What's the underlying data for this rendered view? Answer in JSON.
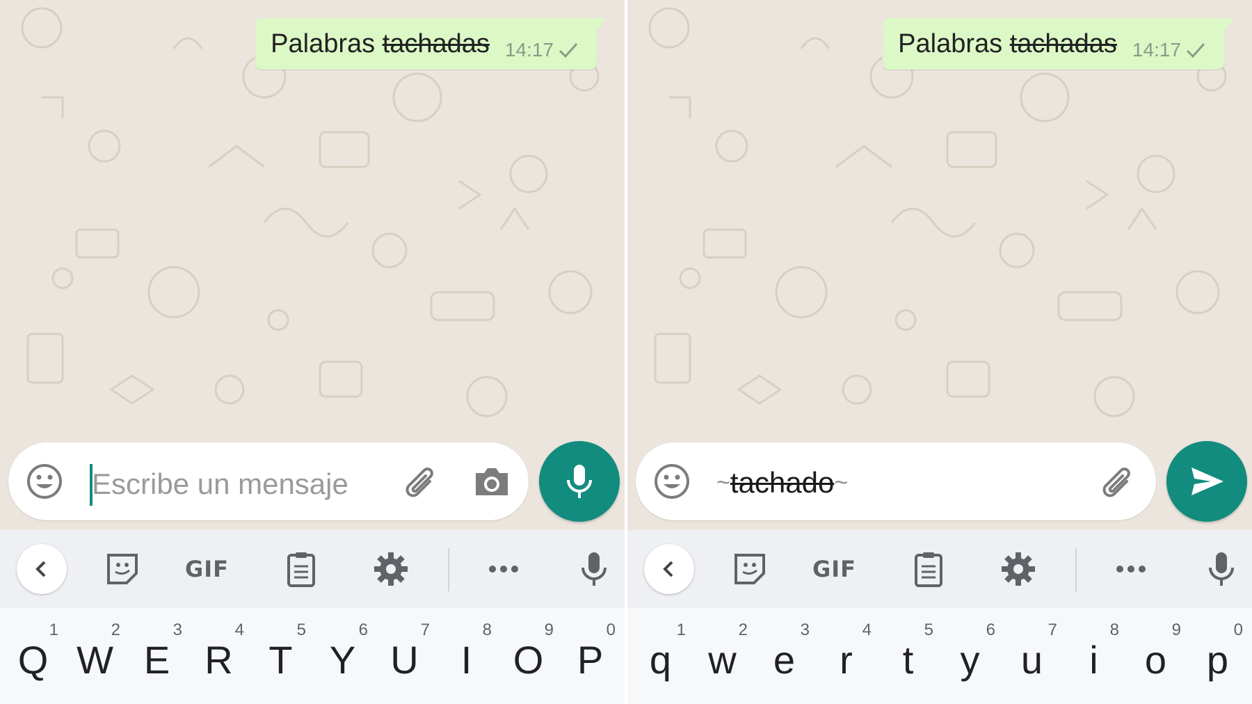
{
  "panels": [
    {
      "message": {
        "plain": "Palabras ",
        "struck": "tachadas",
        "time": "14:17"
      },
      "composer": {
        "placeholder": "Escribe un mensaje",
        "tilde_open": "",
        "typed": "",
        "tilde_close": ""
      },
      "fab": "mic-icon",
      "toolbar": {
        "gif_label": "GIF"
      },
      "keyboard": {
        "keys": [
          {
            "char": "Q",
            "hint": "1"
          },
          {
            "char": "W",
            "hint": "2"
          },
          {
            "char": "E",
            "hint": "3"
          },
          {
            "char": "R",
            "hint": "4"
          },
          {
            "char": "T",
            "hint": "5"
          },
          {
            "char": "Y",
            "hint": "6"
          },
          {
            "char": "U",
            "hint": "7"
          },
          {
            "char": "I",
            "hint": "8"
          },
          {
            "char": "O",
            "hint": "9"
          },
          {
            "char": "P",
            "hint": "0"
          }
        ]
      }
    },
    {
      "message": {
        "plain": "Palabras ",
        "struck": "tachadas",
        "time": "14:17"
      },
      "composer": {
        "placeholder": "",
        "tilde_open": "~",
        "typed": "tachado",
        "tilde_close": "~"
      },
      "fab": "send-icon",
      "toolbar": {
        "gif_label": "GIF"
      },
      "keyboard": {
        "keys": [
          {
            "char": "q",
            "hint": "1"
          },
          {
            "char": "w",
            "hint": "2"
          },
          {
            "char": "e",
            "hint": "3"
          },
          {
            "char": "r",
            "hint": "4"
          },
          {
            "char": "t",
            "hint": "5"
          },
          {
            "char": "y",
            "hint": "6"
          },
          {
            "char": "u",
            "hint": "7"
          },
          {
            "char": "i",
            "hint": "8"
          },
          {
            "char": "o",
            "hint": "9"
          },
          {
            "char": "p",
            "hint": "0"
          }
        ]
      }
    }
  ],
  "colors": {
    "bubble": "#dcf8c6",
    "accent": "#128c7e",
    "chat_bg": "#ece5dd",
    "toolbar_bg": "#eef0f3"
  }
}
